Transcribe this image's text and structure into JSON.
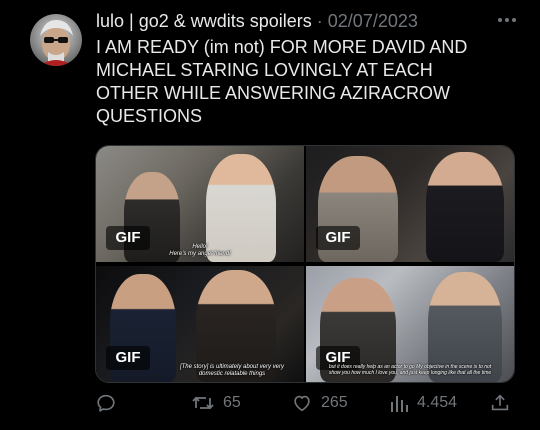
{
  "tweet": {
    "display_name": "lulo | go2 & wwdits spoilers",
    "separator": " · ",
    "date": "02/07/2023",
    "text": "I AM READY (im not) FOR MORE DAVID AND\nMICHAEL STARING LOVINGLY AT EACH\nOTHER WHILE ANSWERING AZIRACROW\nQUESTIONS"
  },
  "media": [
    {
      "badge": "GIF",
      "caption_line1": "Hello!",
      "caption_line2": "Here's my angel friend!"
    },
    {
      "badge": "GIF",
      "caption_line1": "",
      "caption_line2": ""
    },
    {
      "badge": "GIF",
      "caption_line1": "[The story] is ultimately about very very",
      "caption_line2": "domestic relatable things"
    },
    {
      "badge": "GIF",
      "caption_line1": "but it does really help as an actor to go   My objective in the scene is to not",
      "caption_line2": "show you how much I love you, and just keep longing like that all the time"
    }
  ],
  "actions": {
    "reply_count": "",
    "retweet_count": "65",
    "like_count": "265",
    "view_count": "4.454"
  },
  "icons": {
    "more": "more-dots-icon",
    "reply": "reply-bubble-icon",
    "retweet": "retweet-icon",
    "like": "heart-icon",
    "views": "views-bar-chart-icon",
    "share": "share-upload-icon"
  },
  "colors": {
    "background": "#000000",
    "text_primary": "#e7e9ea",
    "text_secondary": "#71767b"
  }
}
